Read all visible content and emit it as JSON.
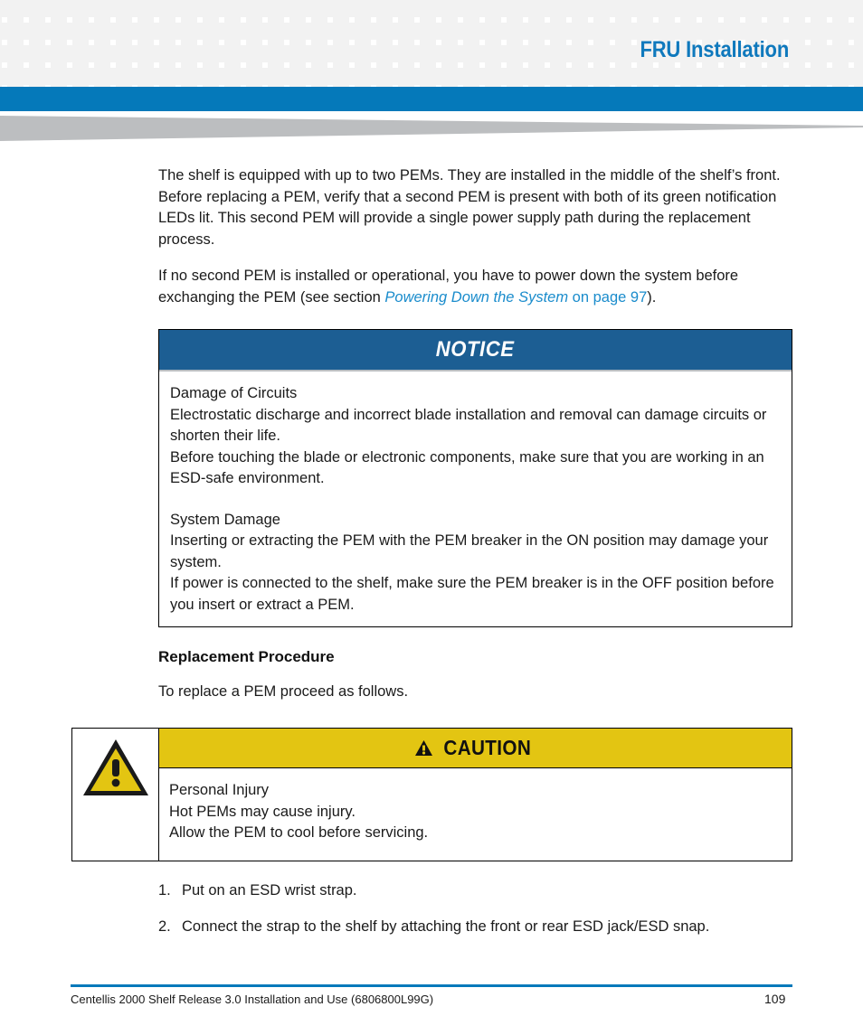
{
  "header": {
    "title": "FRU Installation"
  },
  "body": {
    "paragraph1": "The shelf is equipped with up to two PEMs. They are installed in the middle of the shelf’s front. Before replacing a PEM, verify that a second PEM is present with both of its green notification LEDs lit. This second PEM will provide a single power supply path during the replacement process.",
    "paragraph2_pre": "If no second PEM is installed or operational, you have to power down the system before exchanging the PEM (see section ",
    "paragraph2_xref_italic": "Powering Down the System",
    "paragraph2_xref_tail": " on page 97",
    "paragraph2_post": ")."
  },
  "notice": {
    "label": "NOTICE",
    "group1_title": "Damage of Circuits",
    "group1_line1": "Electrostatic discharge and incorrect blade installation and removal can damage circuits or shorten their life.",
    "group1_line2": "Before touching the blade or electronic components, make sure that you are working in an ESD-safe environment.",
    "group2_title": "System Damage",
    "group2_line1": "Inserting or extracting the PEM with the PEM breaker in the ON position may damage your system.",
    "group2_line2": "If power is connected to the shelf, make sure the PEM breaker is in the OFF position before you insert or extract a PEM."
  },
  "section": {
    "heading": "Replacement Procedure",
    "intro": "To replace a PEM proceed as follows."
  },
  "caution": {
    "label": "CAUTION",
    "icon": "warning-triangle-icon",
    "line1": "Personal Injury",
    "line2": "Hot PEMs may cause injury.",
    "line3": "Allow the PEM to cool before servicing."
  },
  "steps": [
    {
      "num": "1.",
      "text": "Put on an ESD wrist strap."
    },
    {
      "num": "2.",
      "text": "Connect the strap to the shelf by attaching the front or rear ESD jack/ESD snap."
    }
  ],
  "footer": {
    "left": "Centellis 2000 Shelf Release 3.0 Installation and Use (6806800L99G)",
    "page": "109"
  },
  "colors": {
    "brand_blue": "#0579ba",
    "title_blue": "#0f79bd",
    "notice_blue": "#1c5e93",
    "caution_yellow": "#e3c512",
    "xref_blue": "#1a8ccc",
    "pattern_gray": "#f2f2f2",
    "wedge_gray": "#bcbec0"
  }
}
